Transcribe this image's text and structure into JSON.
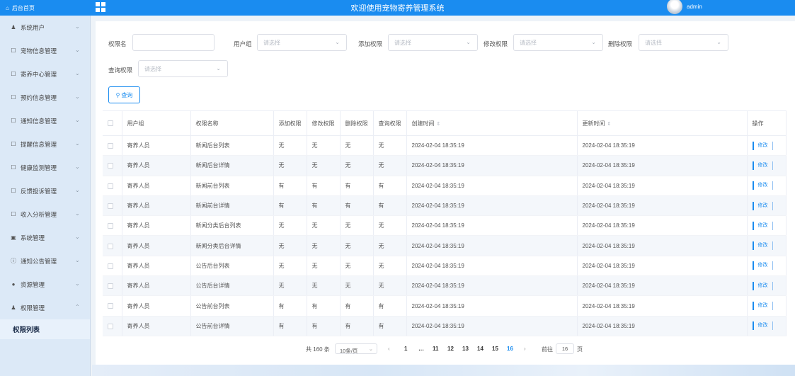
{
  "header": {
    "home_label": "后台首页",
    "title": "欢迎使用宠物寄养管理系统",
    "username": "admin"
  },
  "sidebar": {
    "items": [
      {
        "label": "系统用户",
        "icon": "user-icon"
      },
      {
        "label": "宠物信息管理",
        "icon": "document-icon"
      },
      {
        "label": "寄养中心管理",
        "icon": "document-icon"
      },
      {
        "label": "预约信息管理",
        "icon": "document-icon"
      },
      {
        "label": "通知信息管理",
        "icon": "document-icon"
      },
      {
        "label": "提醒信息管理",
        "icon": "document-icon"
      },
      {
        "label": "健康监测管理",
        "icon": "document-icon"
      },
      {
        "label": "反馈投诉管理",
        "icon": "document-icon"
      },
      {
        "label": "收入分析管理",
        "icon": "document-icon"
      },
      {
        "label": "系统管理",
        "icon": "picture-icon"
      },
      {
        "label": "通知公告管理",
        "icon": "info-icon"
      },
      {
        "label": "资源管理",
        "icon": "location-icon"
      },
      {
        "label": "权限管理",
        "icon": "user-icon"
      }
    ],
    "active_sub": "权限列表"
  },
  "filters": {
    "perm_name_label": "权限名",
    "user_group_label": "用户组",
    "add_perm_label": "添加权限",
    "edit_perm_label": "修改权限",
    "delete_perm_label": "删除权限",
    "query_perm_label": "查询权限",
    "select_placeholder": "请选择",
    "search_button": "查询"
  },
  "table": {
    "headers": {
      "user_group": "用户组",
      "perm_name": "权限名称",
      "add": "添加权限",
      "edit": "修改权限",
      "delete": "删除权限",
      "query": "查询权限",
      "created": "创建时间",
      "updated": "更新时间",
      "ops": "操作"
    },
    "edit_label": "修改",
    "rows": [
      {
        "group": "寄养人员",
        "name": "新闻后台列表",
        "add": "无",
        "edit": "无",
        "delete": "无",
        "query": "无",
        "created": "2024-02-04 18:35:19",
        "updated": "2024-02-04 18:35:19"
      },
      {
        "group": "寄养人员",
        "name": "新闻后台详情",
        "add": "无",
        "edit": "无",
        "delete": "无",
        "query": "无",
        "created": "2024-02-04 18:35:19",
        "updated": "2024-02-04 18:35:19"
      },
      {
        "group": "寄养人员",
        "name": "新闻前台列表",
        "add": "有",
        "edit": "有",
        "delete": "有",
        "query": "有",
        "created": "2024-02-04 18:35:19",
        "updated": "2024-02-04 18:35:19"
      },
      {
        "group": "寄养人员",
        "name": "新闻前台详情",
        "add": "有",
        "edit": "有",
        "delete": "有",
        "query": "有",
        "created": "2024-02-04 18:35:19",
        "updated": "2024-02-04 18:35:19"
      },
      {
        "group": "寄养人员",
        "name": "新闻分类后台列表",
        "add": "无",
        "edit": "无",
        "delete": "无",
        "query": "无",
        "created": "2024-02-04 18:35:19",
        "updated": "2024-02-04 18:35:19"
      },
      {
        "group": "寄养人员",
        "name": "新闻分类后台详情",
        "add": "无",
        "edit": "无",
        "delete": "无",
        "query": "无",
        "created": "2024-02-04 18:35:19",
        "updated": "2024-02-04 18:35:19"
      },
      {
        "group": "寄养人员",
        "name": "公告后台列表",
        "add": "无",
        "edit": "无",
        "delete": "无",
        "query": "无",
        "created": "2024-02-04 18:35:19",
        "updated": "2024-02-04 18:35:19"
      },
      {
        "group": "寄养人员",
        "name": "公告后台详情",
        "add": "无",
        "edit": "无",
        "delete": "无",
        "query": "无",
        "created": "2024-02-04 18:35:19",
        "updated": "2024-02-04 18:35:19"
      },
      {
        "group": "寄养人员",
        "name": "公告前台列表",
        "add": "有",
        "edit": "有",
        "delete": "有",
        "query": "有",
        "created": "2024-02-04 18:35:19",
        "updated": "2024-02-04 18:35:19"
      },
      {
        "group": "寄养人员",
        "name": "公告前台详情",
        "add": "有",
        "edit": "有",
        "delete": "有",
        "query": "有",
        "created": "2024-02-04 18:35:19",
        "updated": "2024-02-04 18:35:19"
      }
    ]
  },
  "pagination": {
    "total": "共 160 条",
    "page_size": "10条/页",
    "prev": "‹",
    "next": "›",
    "pages": [
      "1",
      "…",
      "11",
      "12",
      "13",
      "14",
      "15",
      "16"
    ],
    "current": "16",
    "goto_label": "前往",
    "goto_value": "16",
    "page_suffix": "页"
  },
  "colors": {
    "accent": "#1a8cf0",
    "sidebar_bg": "#dce9f7"
  }
}
